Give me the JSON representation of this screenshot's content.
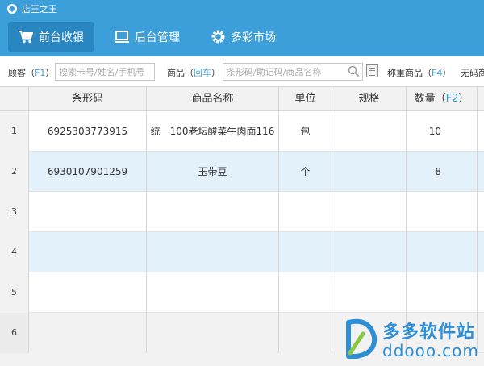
{
  "app": {
    "title": "店王之王"
  },
  "nav": {
    "items": [
      {
        "label": "前台收银",
        "icon": "cart-icon",
        "active": true
      },
      {
        "label": "后台管理",
        "icon": "monitor-icon",
        "active": false
      },
      {
        "label": "多彩市场",
        "icon": "gear-icon",
        "active": false
      }
    ]
  },
  "toolbar": {
    "customer_label": "顾客（",
    "customer_key": "F1",
    "customer_close": "）",
    "customer_placeholder": "搜索卡号/姓名/手机号",
    "product_label": "商品（",
    "product_key": "回车",
    "product_close": "）",
    "product_placeholder": "条形码/助记码/商品名称",
    "weigh_label": "称重商品（",
    "weigh_key": "F4",
    "weigh_close": "）",
    "nocode_label": "无码商"
  },
  "grid": {
    "columns": {
      "barcode": "条形码",
      "name": "商品名称",
      "unit": "单位",
      "spec": "规格",
      "qty": "数量（",
      "qty_key": "F2",
      "qty_close": "）"
    },
    "rows": [
      {
        "index": "1",
        "barcode": "6925303773915",
        "name": "统一100老坛酸菜牛肉面116",
        "unit": "包",
        "spec": "",
        "qty": "10"
      },
      {
        "index": "2",
        "barcode": "6930107901259",
        "name": "玉带豆",
        "unit": "个",
        "spec": "",
        "qty": "8"
      },
      {
        "index": "3",
        "barcode": "",
        "name": "",
        "unit": "",
        "spec": "",
        "qty": ""
      },
      {
        "index": "4",
        "barcode": "",
        "name": "",
        "unit": "",
        "spec": "",
        "qty": ""
      },
      {
        "index": "5",
        "barcode": "",
        "name": "",
        "unit": "",
        "spec": "",
        "qty": ""
      },
      {
        "index": "6",
        "barcode": "",
        "name": "",
        "unit": "",
        "spec": "",
        "qty": ""
      }
    ]
  },
  "watermark": {
    "name": "多多软件站",
    "url": "ddooo.com"
  },
  "colors": {
    "brand": "#3d9fd9",
    "nav_active": "#2a86c0",
    "row_alt": "#e3f1fb"
  }
}
